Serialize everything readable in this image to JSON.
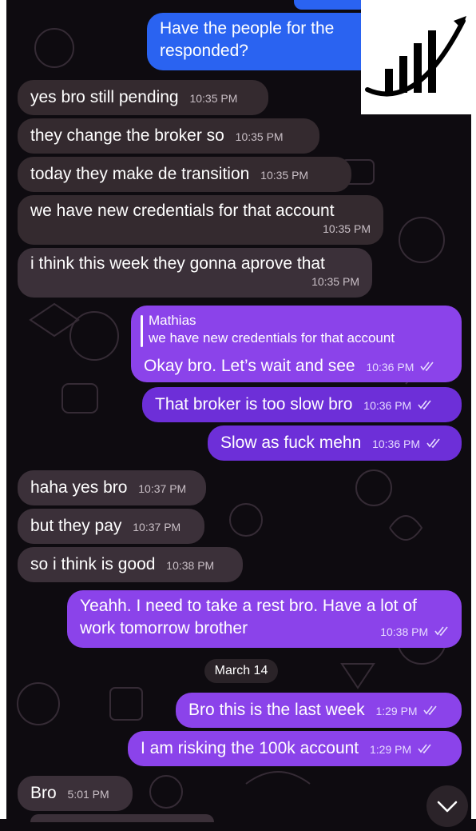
{
  "colors": {
    "incoming_bubble": "#3b3039",
    "outgoing_bubble": "#8b43ea",
    "outgoing_top_bubble": "#2a63f1",
    "background": "#0e0b10"
  },
  "messages": {
    "m0": {
      "text_line1": "Have the people for the",
      "text_line2": "responded?"
    },
    "m1": {
      "text": "yes bro still pending",
      "time": "10:35 PM"
    },
    "m2": {
      "text": "they change the broker so",
      "time": "10:35 PM"
    },
    "m3": {
      "text": "today they make de transition",
      "time": "10:35 PM"
    },
    "m4": {
      "text": "we have new credentials for that account",
      "time": "10:35 PM"
    },
    "m5": {
      "text": "i think this week they gonna aprove that",
      "time": "10:35 PM"
    },
    "m6": {
      "quote_author": "Mathias",
      "quote_text": "we have new credentials for that account",
      "text": "Okay bro. Let’s wait and see",
      "time": "10:36 PM"
    },
    "m7": {
      "text": "That broker is too slow bro",
      "time": "10:36 PM"
    },
    "m8": {
      "text": "Slow as fuck mehn",
      "time": "10:36 PM"
    },
    "m9": {
      "text": "haha yes bro",
      "time": "10:37 PM"
    },
    "m10": {
      "text": "but they pay",
      "time": "10:37 PM"
    },
    "m11": {
      "text": "so i think is good",
      "time": "10:38 PM"
    },
    "m12": {
      "text_line1": "Yeahh. I need to take a rest bro. Have a lot of",
      "text_line2": "work tomorrow brother",
      "time": "10:38 PM"
    },
    "m13": {
      "text": "Bro this is the last week",
      "time": "1:29 PM"
    },
    "m14": {
      "text": "I am risking the 100k account",
      "time": "1:29 PM"
    },
    "m15": {
      "text": "Bro",
      "time": "5:01 PM"
    }
  },
  "date_separator": "March 14",
  "icons": {
    "read_ticks": "double-check-icon",
    "logo": "growth-chart-logo",
    "scroll_down": "chevron-down-icon"
  }
}
